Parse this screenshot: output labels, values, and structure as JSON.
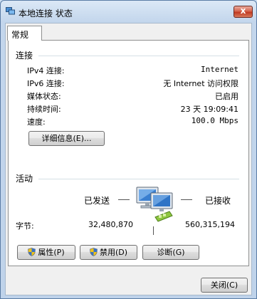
{
  "window": {
    "title": "本地连接 状态",
    "close_label": "x"
  },
  "tabs": [
    {
      "label": "常规"
    }
  ],
  "connection": {
    "heading": "连接",
    "rows": [
      {
        "label": "IPv4 连接:",
        "value": "Internet"
      },
      {
        "label": "IPv6 连接:",
        "value": "无 Internet 访问权限"
      },
      {
        "label": "媒体状态:",
        "value": "已启用"
      },
      {
        "label": "持续时间:",
        "value": "23 天 19:09:41"
      },
      {
        "label": "速度:",
        "value": "100.0 Mbps"
      }
    ],
    "details_button": "详细信息(E)..."
  },
  "activity": {
    "heading": "活动",
    "sent_label": "已发送",
    "received_label": "已接收",
    "bytes_label": "字节:",
    "bytes_sent": "32,480,870",
    "bytes_received": "560,315,194"
  },
  "buttons": {
    "properties": "属性(P)",
    "disable": "禁用(D)",
    "diagnose": "诊断(G)",
    "close": "关闭(C)"
  },
  "icons": {
    "app": "network-connection-icon",
    "activity": "network-computer-icon",
    "shield": "uac-shield-icon"
  },
  "colors": {
    "title_bar": "#c3d6ec",
    "close_button": "#c13a22",
    "group_line": "#d5dfe5"
  }
}
